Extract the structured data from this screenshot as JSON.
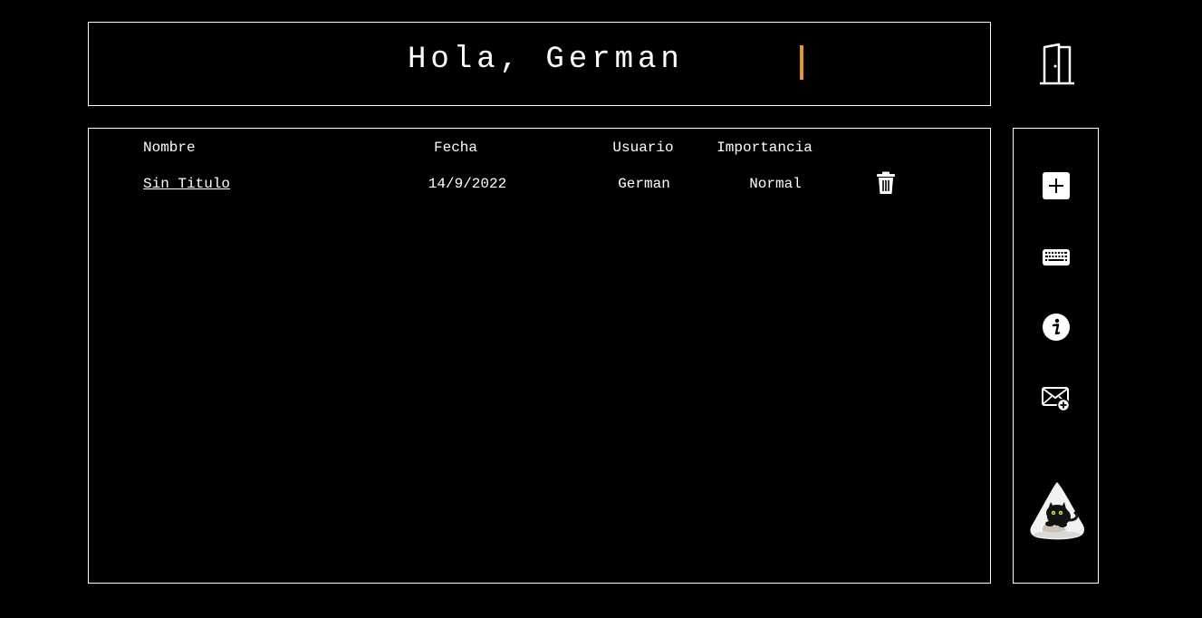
{
  "header": {
    "greeting": "Hola, German"
  },
  "table": {
    "columns": [
      "Nombre",
      "Fecha",
      "Usuario",
      "Importancia"
    ],
    "rows": [
      {
        "nombre": "Sin Titulo",
        "fecha": "14/9/2022",
        "usuario": "German",
        "importancia": "Normal"
      }
    ]
  },
  "sidebar": {
    "icons": [
      "plus-square-icon",
      "keyboard-icon",
      "info-icon",
      "mail-plus-icon",
      "cat-avatar-icon"
    ]
  },
  "colors": {
    "background": "#000000",
    "foreground": "#ffffff",
    "cursor": "#e2962b"
  }
}
